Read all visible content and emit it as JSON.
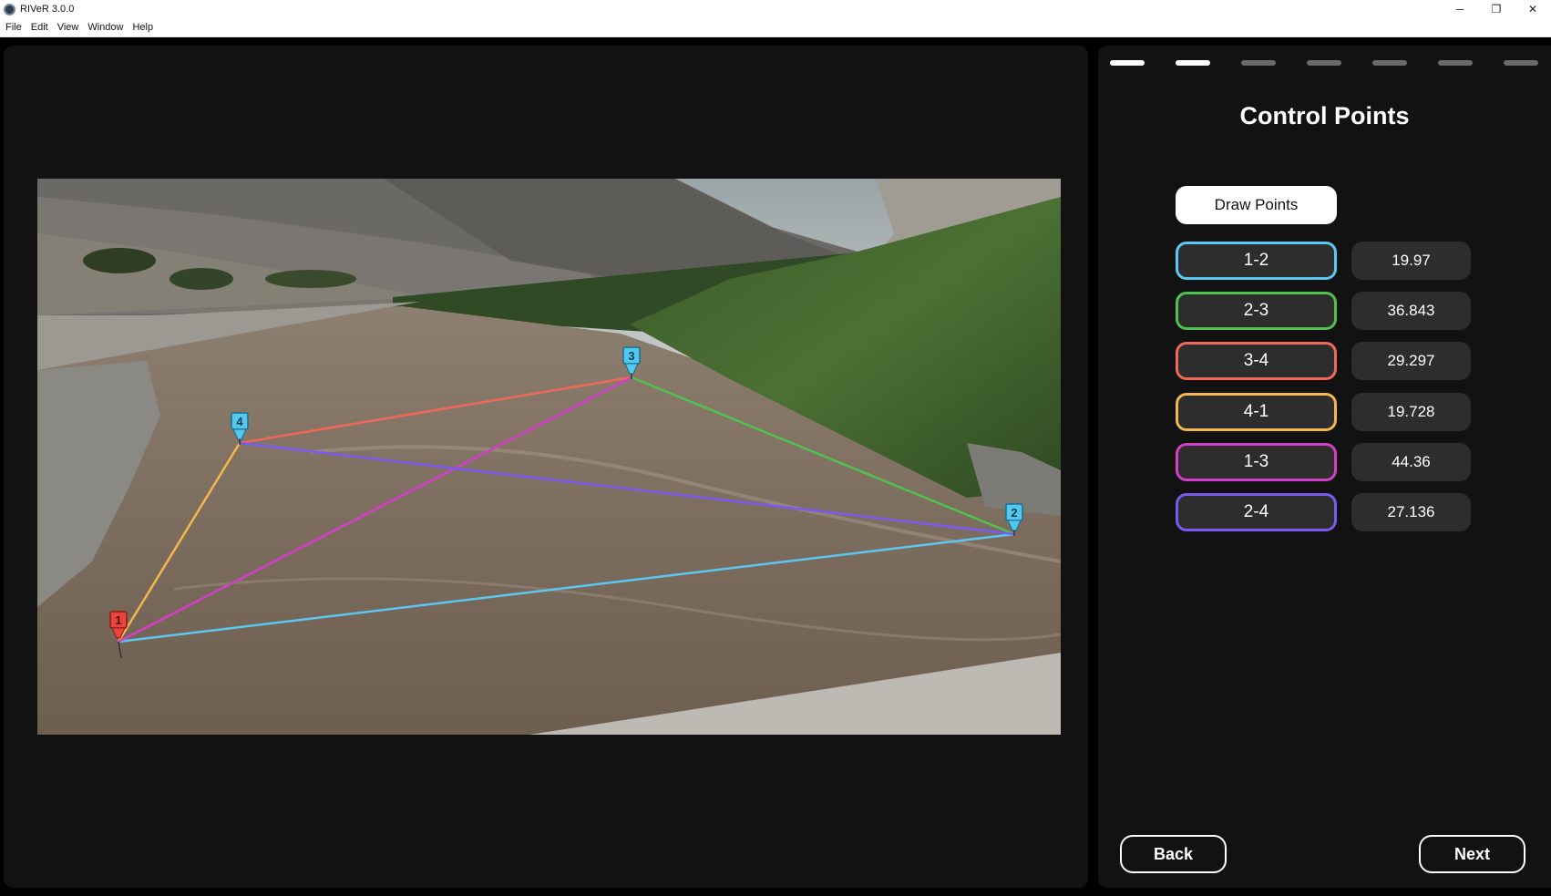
{
  "window": {
    "title": "RIVeR 3.0.0",
    "minimize_glyph": "─",
    "restore_glyph": "❐",
    "close_glyph": "✕"
  },
  "menu": [
    "File",
    "Edit",
    "View",
    "Window",
    "Help"
  ],
  "progress": {
    "total_steps": 7,
    "completed_steps": 2
  },
  "panel": {
    "title": "Control Points",
    "draw_button": "Draw Points",
    "segments": [
      {
        "label": "1-2",
        "value": "19.97",
        "color": "#5bc8f0"
      },
      {
        "label": "2-3",
        "value": "36.843",
        "color": "#4fc24f"
      },
      {
        "label": "3-4",
        "value": "29.297",
        "color": "#f0685a"
      },
      {
        "label": "4-1",
        "value": "19.728",
        "color": "#f2b84b"
      },
      {
        "label": "1-3",
        "value": "44.36",
        "color": "#d43fc9"
      },
      {
        "label": "2-4",
        "value": "27.136",
        "color": "#7a5af0"
      }
    ],
    "back_button": "Back",
    "next_button": "Next"
  },
  "markers": [
    {
      "label": "1",
      "color": "#e8453c"
    },
    {
      "label": "2",
      "color": "#52c8ee"
    },
    {
      "label": "3",
      "color": "#52c8ee"
    },
    {
      "label": "4",
      "color": "#52c8ee"
    }
  ],
  "icons": {
    "app": "river-app-icon",
    "marker": "pushpin-icon"
  }
}
